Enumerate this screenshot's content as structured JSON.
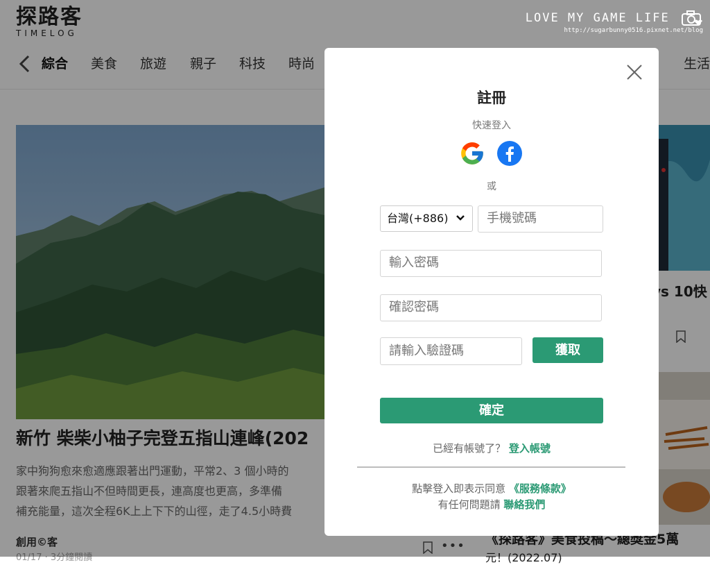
{
  "header": {
    "logo_cn": "探路客",
    "logo_en": "TIMELOG",
    "watermark_title": "LOVE MY GAME LIFE",
    "watermark_url": "http://sugarbunny0516.pixnet.net/blog"
  },
  "nav": {
    "items": [
      "綜合",
      "美食",
      "旅遊",
      "親子",
      "科技",
      "時尚",
      "生活"
    ],
    "active_index": 0
  },
  "article": {
    "title": "新竹 柴柴小柚子完登五指山連峰(202",
    "desc_lines": [
      "家中狗狗愈來愈適應跟著出門運動，平常2、3 個小時的",
      "跟著來爬五指山不但時間更長，連高度也更高，多準備",
      "補充能量，這次全程6K上上下下的山徑，走了4.5小時費"
    ],
    "author": "創用©客",
    "meta": "01/17 · 3分鐘閱讀"
  },
  "side": {
    "title1": "vs 10快",
    "bottom_title": "《探路客》美食投稿～總獎金5萬",
    "bottom_sub": "元！(2022.07)"
  },
  "modal": {
    "title": "註冊",
    "quick_login": "快速登入",
    "or": "或",
    "country_select": "台灣(+886)",
    "phone_placeholder": "手機號碼",
    "password_placeholder": "輸入密碼",
    "confirm_password_placeholder": "確認密碼",
    "code_placeholder": "請輸入驗證碼",
    "get_code_button": "獲取",
    "confirm_button": "確定",
    "have_account": "已經有帳號了？",
    "login_link": "登入帳號",
    "terms_prefix": "點擊登入即表示同意",
    "terms_link": "《服務條款》",
    "contact_prefix": "有任何問題請",
    "contact_link": "聯絡我們"
  },
  "colors": {
    "accent": "#2b9a74",
    "overlay": "rgba(0,0,0,0.40)"
  }
}
